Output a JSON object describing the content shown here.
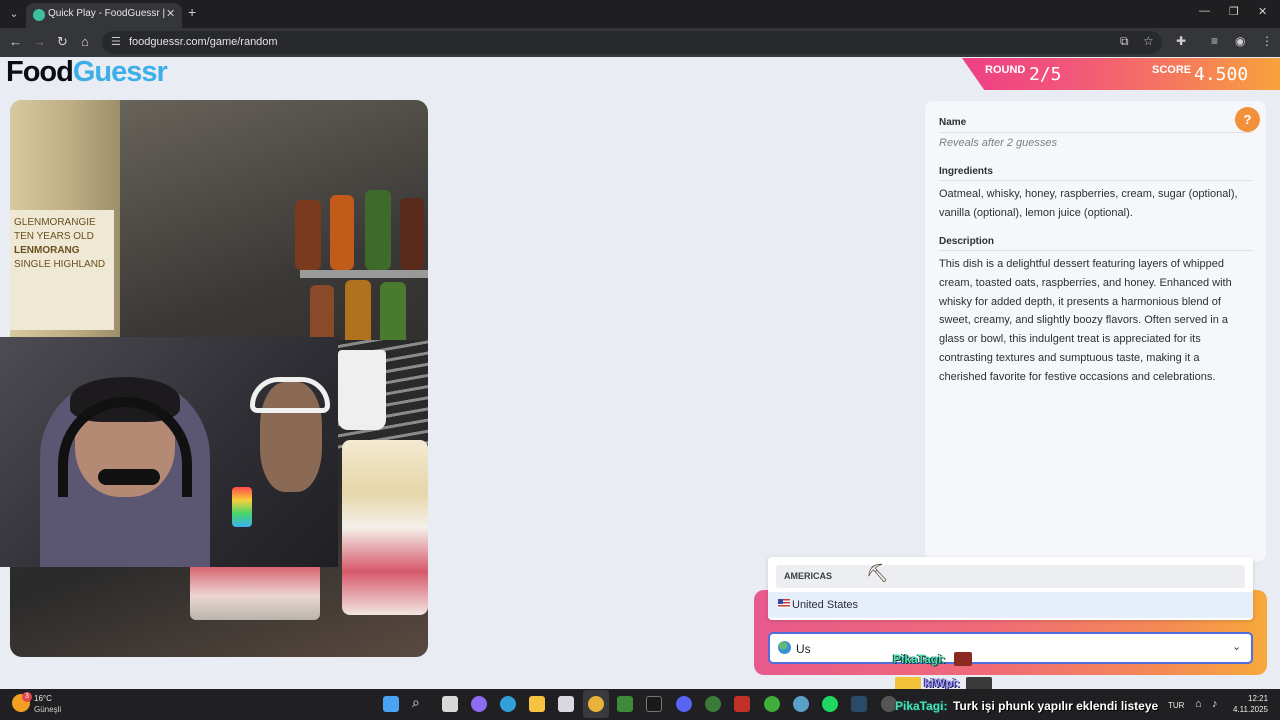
{
  "browser": {
    "tab_title": "Quick Play - FoodGuessr | Food",
    "url": "foodguessr.com/game/random"
  },
  "logo": {
    "part1": "Food",
    "part2": "Guessr"
  },
  "scoreboard": {
    "round_label": "ROUND",
    "round_value": "2/5",
    "score_label": "SCORE",
    "score_value": "4.500"
  },
  "clue_panel": {
    "help_icon": "question-icon",
    "name_title": "Name",
    "name_hint": "Reveals after 2 guesses",
    "ingredients_title": "Ingredients",
    "ingredients_lines": [
      "Oatmeal, whisky, honey, raspberries, cream, sugar (optional),",
      "vanilla (optional), lemon juice (optional)."
    ],
    "description_title": "Description",
    "description_lines": [
      "This dish is a delightful dessert featuring layers of whipped",
      "cream, toasted oats, raspberries, and honey. Enhanced with",
      "whisky for added depth, it presents a harmonious blend of",
      "sweet, creamy, and slightly boozy flavors. Often served in a",
      "glass or bowl, this indulgent treat is appreciated for its",
      "contrasting textures and sumptuous taste, making it a",
      "cherished favorite for festive occasions and celebrations."
    ]
  },
  "photo": {
    "bottle_label_lines": [
      "GLENMORANGIE",
      "TEN YEARS OLD",
      "LENMORANG",
      "SINGLE HIGHLAND"
    ]
  },
  "country_select": {
    "group_label": "AMERICAS",
    "option_label": "United States",
    "input_value": "Us"
  },
  "stream_overlay": {
    "user1": "PikaTagi:",
    "user2": "kiWpi:",
    "message_user": "PikaTagi:",
    "message_text": "Turk işi phunk yapılır eklendi listeye"
  },
  "taskbar": {
    "weather_temp": "16°C",
    "weather_desc": "Güneşli",
    "weather_badge": "3",
    "language": "TUR",
    "time": "12:21",
    "date": "4.11.2025"
  },
  "colors": {
    "brand_dark": "#0b0d14",
    "brand_blue": "#3dafe8",
    "accent_orange": "#f2913a",
    "banner_pink": "#ee3f85",
    "focus_blue": "#4f6edc"
  }
}
